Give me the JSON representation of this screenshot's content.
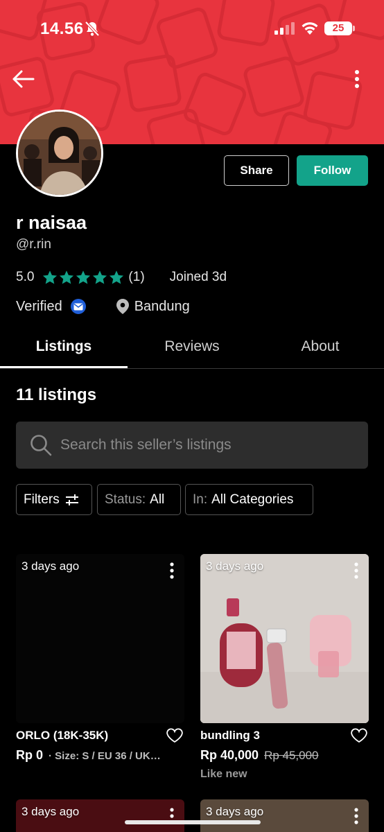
{
  "status_bar": {
    "time": "14.56",
    "battery": "25"
  },
  "profile": {
    "name": "r naisaa",
    "handle": "@r.rin",
    "rating": "5.0",
    "review_count": "(1)",
    "joined": "Joined 3d",
    "verified_label": "Verified",
    "location": "Bandung",
    "share_label": "Share",
    "follow_label": "Follow"
  },
  "tabs": [
    {
      "label": "Listings",
      "active": true
    },
    {
      "label": "Reviews",
      "active": false
    },
    {
      "label": "About",
      "active": false
    }
  ],
  "listings_count": "11 listings",
  "search": {
    "placeholder": "Search this seller’s listings"
  },
  "filters": {
    "filters_label": "Filters",
    "status_prefix": "Status:",
    "status_value": "All",
    "category_prefix": "In:",
    "category_value": "All Categories"
  },
  "listings": [
    {
      "date": "3 days ago",
      "title": "ORLO (18K-35K)",
      "price": "Rp 0",
      "meta": "· Size: S / EU 36 / UK…",
      "old_price": "",
      "condition": ""
    },
    {
      "date": "3 days ago",
      "title": "bundling 3",
      "price": "Rp 40,000",
      "meta": "",
      "old_price": "Rp 45,000",
      "condition": "Like new"
    },
    {
      "date": "3 days ago"
    },
    {
      "date": "3 days ago"
    }
  ],
  "colors": {
    "header_red": "#e8343e",
    "follow_green": "#13a38a",
    "star_green": "#13a38a",
    "verified_blue": "#1f5ed8"
  }
}
